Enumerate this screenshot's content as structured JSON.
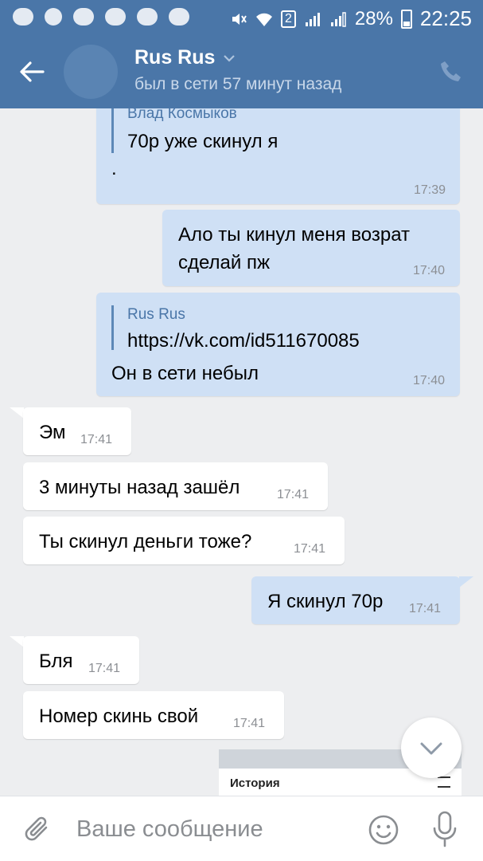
{
  "statusbar": {
    "battery": "28%",
    "time": "22:25",
    "sim_slot": "2"
  },
  "header": {
    "contact_name": "Rus Rus",
    "status": "был в сети 57 минут назад"
  },
  "messages": [
    {
      "id": "m1",
      "direction": "out",
      "quote_author": "Влад Космыков",
      "quote_text": "70р уже скинул я",
      "text": ".",
      "time": "17:39"
    },
    {
      "id": "m2",
      "direction": "out",
      "text_line1": "Ало ты кинул меня возрат",
      "text_line2": "сделай пж",
      "time": "17:40"
    },
    {
      "id": "m3",
      "direction": "out",
      "quote_author": "Rus Rus",
      "quote_text": "https://vk.com/id511670085",
      "text": "Он в сети небыл",
      "time": "17:40"
    },
    {
      "id": "m4",
      "direction": "in",
      "text": "Эм",
      "time": "17:41"
    },
    {
      "id": "m5",
      "direction": "in",
      "text": "3 минуты назад зашёл",
      "time": "17:41"
    },
    {
      "id": "m6",
      "direction": "in",
      "text": "Ты скинул деньги тоже?",
      "time": "17:41"
    },
    {
      "id": "m7",
      "direction": "out",
      "text": "Я скинул 70р",
      "time": "17:41"
    },
    {
      "id": "m8",
      "direction": "in",
      "text": "Бля",
      "time": "17:41"
    },
    {
      "id": "m9",
      "direction": "in",
      "text": "Номер скинь свой",
      "time": "17:41"
    }
  ],
  "attachment_preview": {
    "title": "История"
  },
  "composer": {
    "placeholder": "Ваше сообщение"
  },
  "colors": {
    "header": "#4a76a8",
    "outgoing_bubble": "#cfe0f5",
    "incoming_bubble": "#ffffff",
    "background": "#edeef0"
  },
  "icons": [
    "back-arrow-icon",
    "phone-icon",
    "attach-icon",
    "emoji-icon",
    "mic-icon",
    "chevron-down-icon"
  ]
}
